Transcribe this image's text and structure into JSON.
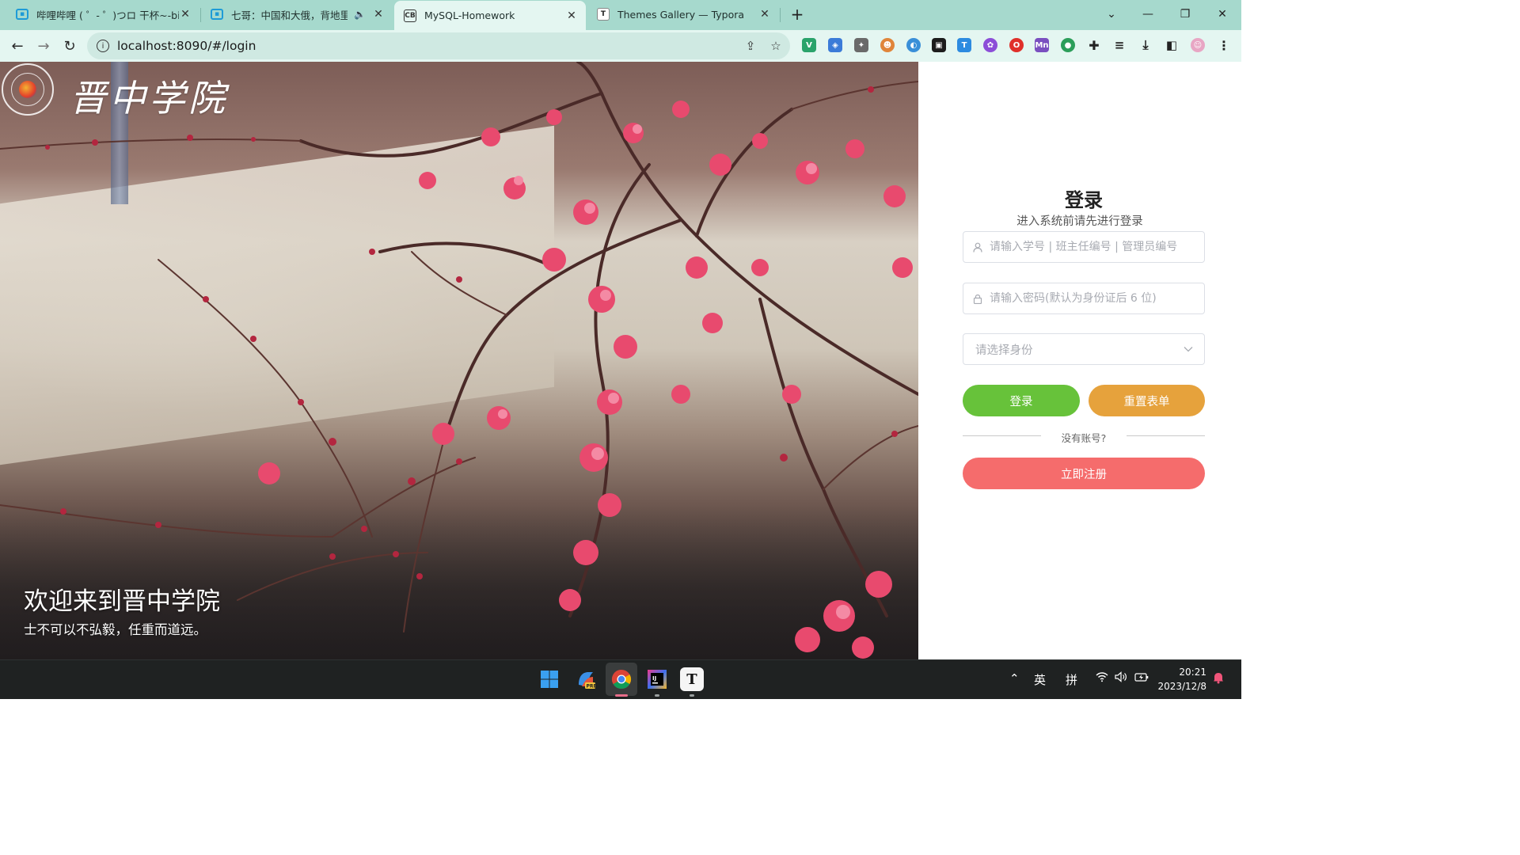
{
  "browser": {
    "tabs": [
      {
        "title": "哔哩哔哩 ( ゜- ゜)つロ 干杯~-bil",
        "icon": "bilibili-icon",
        "active": false
      },
      {
        "title": "七哥：中国和大俄，背地里",
        "icon": "bilibili-icon",
        "active": false,
        "audio": true
      },
      {
        "title": "MySQL-Homework",
        "icon": "cb-icon",
        "favicon_text": "CB",
        "active": true
      },
      {
        "title": "Themes Gallery — Typora",
        "icon": "typora-icon",
        "favicon_text": "T",
        "active": false
      }
    ],
    "url": "localhost:8090/#/login",
    "accent": "#a6d9cd"
  },
  "hero": {
    "school_name": "晋中学院",
    "welcome": "欢迎来到晋中学院",
    "motto": "士不可以不弘毅，任重而道远。"
  },
  "login": {
    "title": "登录",
    "subtitle": "进入系统前请先进行登录",
    "username_placeholder": "请输入学号 | 班主任编号 | 管理员编号",
    "password_placeholder": "请输入密码(默认为身份证后 6 位)",
    "role_placeholder": "请选择身份",
    "login_button": "登录",
    "reset_button": "重置表单",
    "no_account": "没有账号?",
    "register_button": "立即注册",
    "colors": {
      "login": "#67c23a",
      "reset": "#e6a23c",
      "register": "#f56c6c"
    }
  },
  "taskbar": {
    "ime_lang": "英",
    "ime_mode": "拼",
    "time": "20:21",
    "date": "2023/12/8"
  }
}
